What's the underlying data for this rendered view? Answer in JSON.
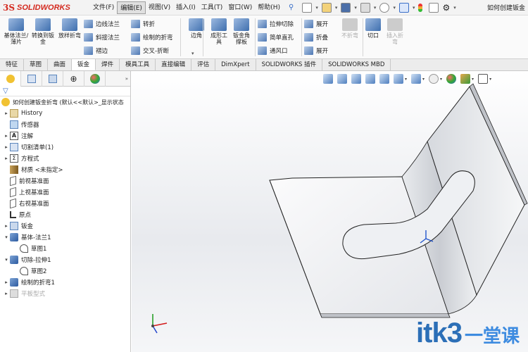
{
  "app": {
    "logo_mark": "3S",
    "logo_text": "SOLIDWORKS",
    "document_title": "如何创建钣金"
  },
  "menu": [
    {
      "label": "文件(F)",
      "active": false
    },
    {
      "label": "编辑(E)",
      "active": true
    },
    {
      "label": "视图(V)",
      "active": false
    },
    {
      "label": "插入(I)",
      "active": false
    },
    {
      "label": "工具(T)",
      "active": false
    },
    {
      "label": "窗口(W)",
      "active": false
    },
    {
      "label": "帮助(H)",
      "active": false
    }
  ],
  "ribbon": {
    "base_flange": "基体法兰/薄片",
    "convert_to_sheet": "转换到钣金",
    "lofted_bend": "放样折弯",
    "edge_flange": "边线法兰",
    "miter_flange": "斜接法兰",
    "hem": "褶边",
    "jog": "转折",
    "sketched_bend": "绘制的折弯",
    "cross_break": "交叉-折断",
    "corners": "边角",
    "forming_tool": "成形工具",
    "sheet_metal_gusset": "钣金角撑板",
    "extruded_cut": "拉伸切除",
    "simple_hole": "简单直孔",
    "vent": "通风口",
    "unfold": "展开",
    "fold": "折叠",
    "flatten": "展开",
    "no_bends": "不折弯",
    "rip": "切口",
    "insert_bends": "插入折弯"
  },
  "tabs": [
    {
      "label": "特征",
      "active": false
    },
    {
      "label": "草图",
      "active": false
    },
    {
      "label": "曲面",
      "active": false
    },
    {
      "label": "钣金",
      "active": true
    },
    {
      "label": "焊件",
      "active": false
    },
    {
      "label": "模具工具",
      "active": false
    },
    {
      "label": "直接编辑",
      "active": false
    },
    {
      "label": "评估",
      "active": false
    },
    {
      "label": "DimXpert",
      "active": false
    },
    {
      "label": "SOLIDWORKS 插件",
      "active": false
    },
    {
      "label": "SOLIDWORKS MBD",
      "active": false
    }
  ],
  "tree": {
    "root": "如何创建钣金折弯 (默认<<默认>_显示状态",
    "items": [
      {
        "label": "History",
        "expand": "▸",
        "icon": "history-folder-icon",
        "indent": 0
      },
      {
        "label": "传感器",
        "expand": "",
        "icon": "sensor-icon",
        "indent": 0
      },
      {
        "label": "注解",
        "expand": "▸",
        "icon": "annotation-icon",
        "indent": 0
      },
      {
        "label": "切割清单(1)",
        "expand": "▸",
        "icon": "cut-list-icon",
        "indent": 0
      },
      {
        "label": "方程式",
        "expand": "▸",
        "icon": "equation-icon",
        "indent": 0
      },
      {
        "label": "材质 <未指定>",
        "expand": "",
        "icon": "material-icon",
        "indent": 0
      },
      {
        "label": "前视基准面",
        "expand": "",
        "icon": "plane-icon",
        "indent": 0
      },
      {
        "label": "上视基准面",
        "expand": "",
        "icon": "plane-icon",
        "indent": 0
      },
      {
        "label": "右视基准面",
        "expand": "",
        "icon": "plane-icon",
        "indent": 0
      },
      {
        "label": "原点",
        "expand": "",
        "icon": "origin-icon",
        "indent": 0
      },
      {
        "label": "钣金",
        "expand": "▸",
        "icon": "sheet-metal-icon",
        "indent": 0
      },
      {
        "label": "基体-法兰1",
        "expand": "▾",
        "icon": "base-flange-icon",
        "indent": 0
      },
      {
        "label": "草图1",
        "expand": "",
        "icon": "sketch-icon",
        "indent": 1
      },
      {
        "label": "切除-拉伸1",
        "expand": "▾",
        "icon": "cut-extrude-icon",
        "indent": 0
      },
      {
        "label": "草图2",
        "expand": "",
        "icon": "sketch-icon",
        "indent": 1
      },
      {
        "label": "绘制的折弯1",
        "expand": "▸",
        "icon": "sketched-bend-icon",
        "indent": 0
      },
      {
        "label": "平板型式",
        "expand": "▸",
        "icon": "flat-pattern-icon",
        "indent": 0,
        "disabled": true
      }
    ]
  },
  "watermark": {
    "brand": "itk3",
    "sub": "一堂课"
  }
}
